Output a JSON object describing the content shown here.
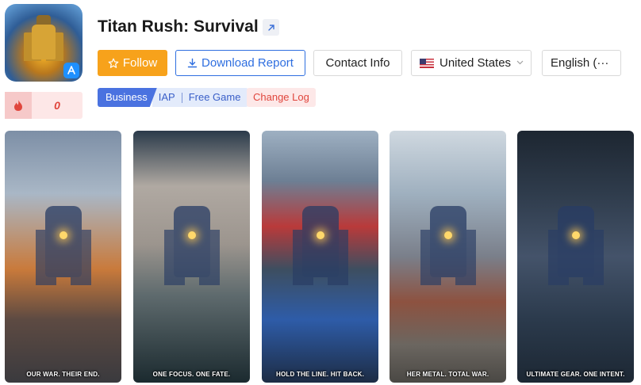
{
  "app": {
    "title": "Titan Rush: Survival",
    "hot_count": "0"
  },
  "actions": {
    "follow_label": "Follow",
    "download_label": "Download Report",
    "contact_label": "Contact Info"
  },
  "filters": {
    "country": "United States",
    "language": "English (···"
  },
  "tags": {
    "business": "Business",
    "items": [
      "IAP",
      "Free Game"
    ],
    "changelog": "Change Log"
  },
  "screenshots": [
    {
      "caption": "OUR WAR. THEIR END."
    },
    {
      "caption": "ONE FOCUS. ONE FATE."
    },
    {
      "caption": "HOLD THE LINE. HIT BACK."
    },
    {
      "caption": "HER METAL. TOTAL WAR."
    },
    {
      "caption": "ULTIMATE GEAR. ONE INTENT."
    }
  ],
  "colors": {
    "follow": "#f7a21b",
    "primary": "#2f6fe0",
    "business_tag": "#4a72e0",
    "changelog": "#e0463d"
  },
  "icons": {
    "external_link": "arrow-up-right-icon",
    "follow": "star-outline-icon",
    "download": "download-icon",
    "hot": "flame-icon",
    "store": "app-store-icon",
    "dropdown": "chevron-down-icon"
  }
}
